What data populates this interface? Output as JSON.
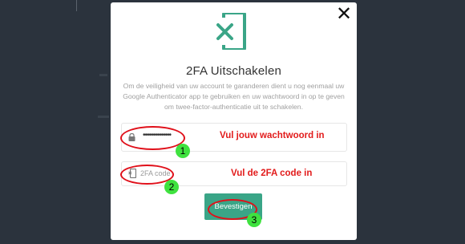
{
  "modal": {
    "title": "2FA Uitschakelen",
    "description": "Om de veiligheid van uw account te garanderen dient u nog eenmaal uw Google Authenticator app te gebruiken en uw wachtwoord in op te geven om twee-factor-authenticatie uit te schakelen.",
    "close_label": "✕",
    "password_value": "••••••••••••••",
    "code_placeholder": "2FA code",
    "submit_label": "Bevestigen"
  },
  "annotations": {
    "hint_password": "Vul jouw wachtwoord in",
    "hint_code": "Vul de 2FA code in",
    "step1": "1",
    "step2": "2",
    "step3": "3"
  },
  "icons": {
    "header": "phone-x-icon",
    "password_field": "lock-icon",
    "code_field": "phone-icon",
    "close": "close-icon"
  },
  "colors": {
    "accent": "#3aa587",
    "annotation_red": "#e21b1b",
    "badge_green": "#3fe23f",
    "backdrop": "#2b333d"
  }
}
